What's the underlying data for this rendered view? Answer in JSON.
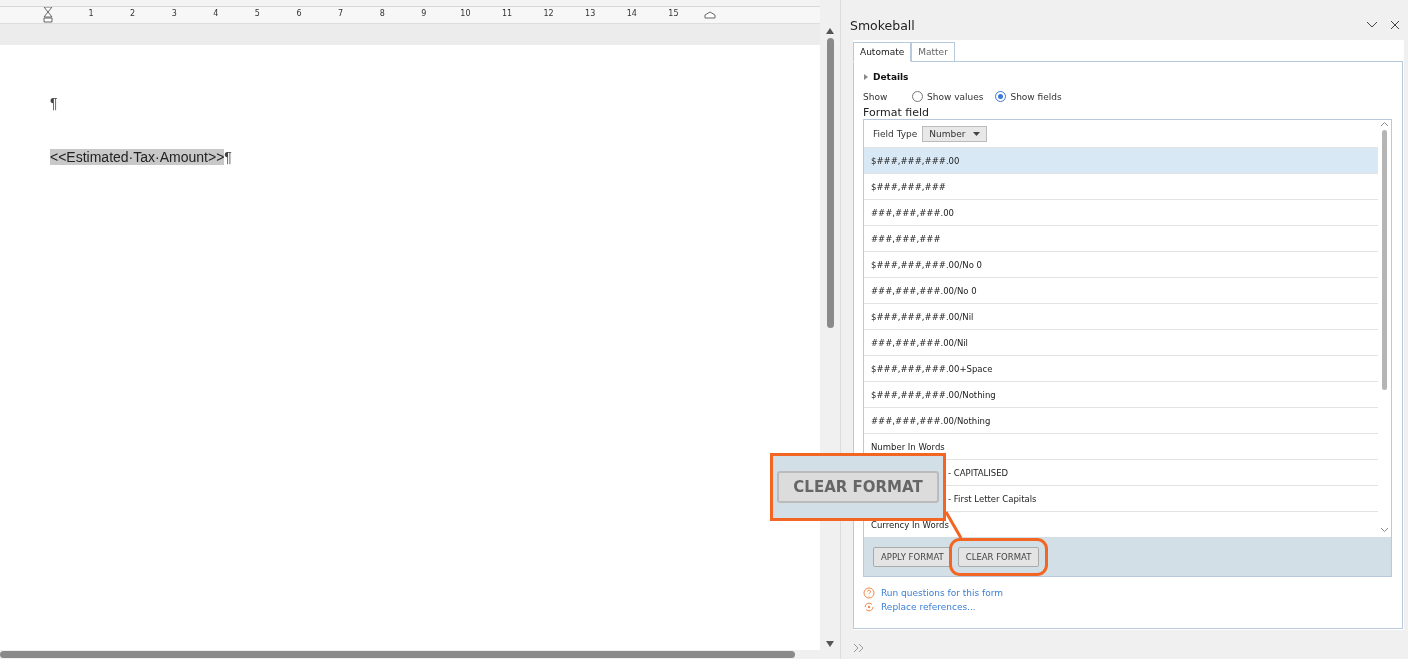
{
  "ruler": {
    "ticks": [
      "1",
      "2",
      "3",
      "4",
      "5",
      "6",
      "7",
      "8",
      "9",
      "10",
      "11",
      "12",
      "13",
      "14",
      "15"
    ]
  },
  "document": {
    "paragraphs": [
      {
        "text": "¶",
        "selected": false
      },
      {
        "text": "<<Estimated·Tax·Amount>>",
        "mark": "¶",
        "selected": true
      }
    ]
  },
  "panel": {
    "title": "Smokeball",
    "tabs": [
      {
        "label": "Automate",
        "selected": true
      },
      {
        "label": "Matter",
        "selected": false
      }
    ],
    "details": {
      "label": "Details",
      "expanded": false
    },
    "show": {
      "label": "Show",
      "options": [
        {
          "label": "Show values",
          "selected": false
        },
        {
          "label": "Show fields",
          "selected": true
        }
      ]
    },
    "format_field": {
      "title": "Format field",
      "field_type_label": "Field Type",
      "field_type": "Number",
      "formats": [
        {
          "text": "$###,###,###.00",
          "selected": true,
          "kind": "plain"
        },
        {
          "text": "$###,###,###",
          "selected": false,
          "kind": "plain"
        },
        {
          "text": "###,###,###.00",
          "selected": false,
          "kind": "plain"
        },
        {
          "text": "###,###,###",
          "selected": false,
          "kind": "plain"
        },
        {
          "text": "$###,###,###.00/No 0",
          "selected": false,
          "kind": "plain"
        },
        {
          "text": "###,###,###.00/No 0",
          "selected": false,
          "kind": "plain"
        },
        {
          "text": "$###,###,###.00/Nil",
          "selected": false,
          "kind": "plain"
        },
        {
          "text": "###,###,###.00/Nil",
          "selected": false,
          "kind": "plain"
        },
        {
          "text": "$###,###,###.00+Space",
          "selected": false,
          "kind": "plain"
        },
        {
          "text": "$###,###,###.00/Nothing",
          "selected": false,
          "kind": "plain"
        },
        {
          "text": "###,###,###.00/Nothing",
          "selected": false,
          "kind": "plain"
        },
        {
          "text": "Number In Words",
          "selected": false,
          "kind": "plain"
        },
        {
          "text": "- CAPITALISED",
          "selected": false,
          "kind": "covered"
        },
        {
          "text": "- First Letter Capitals",
          "selected": false,
          "kind": "covered"
        },
        {
          "text": "Currency In Words",
          "selected": false,
          "kind": "plain"
        }
      ],
      "buttons": [
        {
          "label": "APPLY FORMAT",
          "highlighted": false
        },
        {
          "label": "CLEAR FORMAT",
          "highlighted": true
        }
      ]
    },
    "links": [
      {
        "label": "Run questions for this form",
        "kind": "question"
      },
      {
        "label": "Replace references...",
        "kind": "replace"
      }
    ]
  },
  "callout": {
    "label": "CLEAR FORMAT"
  }
}
